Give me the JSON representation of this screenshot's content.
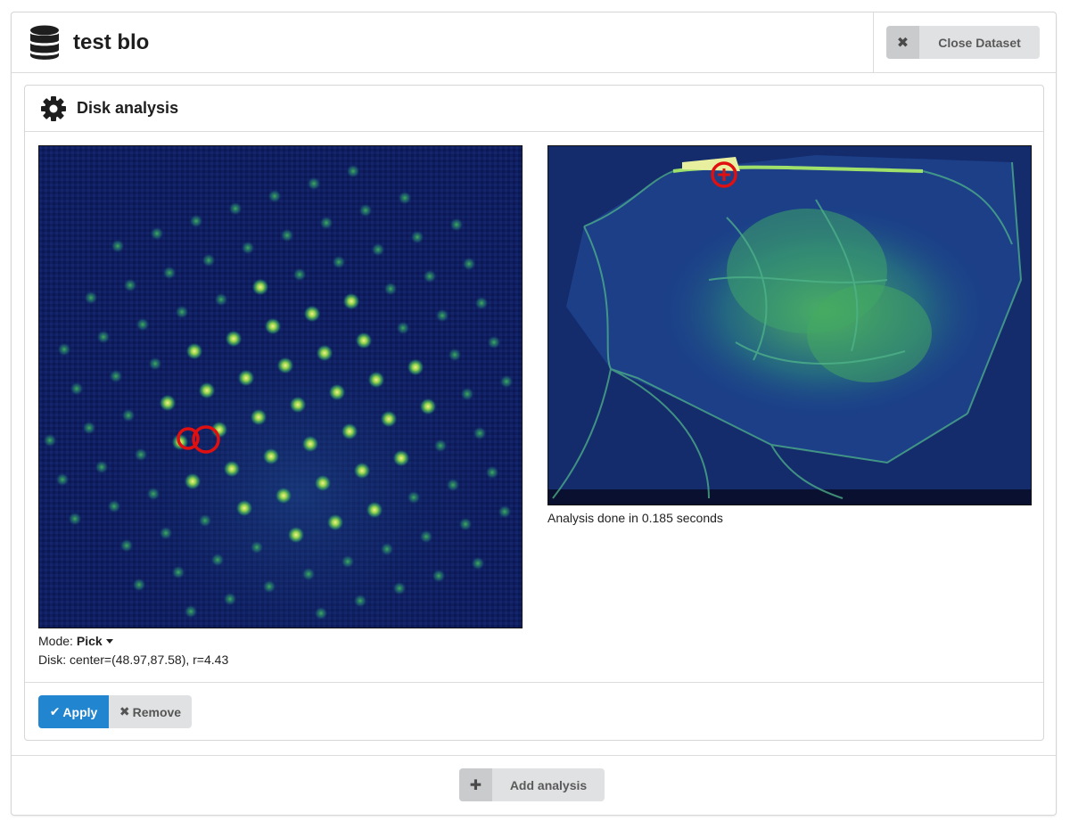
{
  "dataset": {
    "title": "test blo",
    "icon": "database-icon",
    "close_label": "Close Dataset",
    "close_icon": "✖"
  },
  "analysis": {
    "title": "Disk analysis",
    "icon": "gear-icon",
    "mode_label": "Mode:",
    "mode_value": "Pick",
    "disk_info": "Disk: center=(48.97,87.58), r=4.43",
    "status": "Analysis done in 0.185 seconds",
    "apply_label": "Apply",
    "apply_icon": "✔",
    "remove_label": "Remove",
    "remove_icon": "✖"
  },
  "footer": {
    "add_label": "Add analysis",
    "add_icon": "✚"
  },
  "colors": {
    "primary": "#2185d0",
    "button_grey": "#e0e1e2",
    "marker_red": "#e01010"
  }
}
